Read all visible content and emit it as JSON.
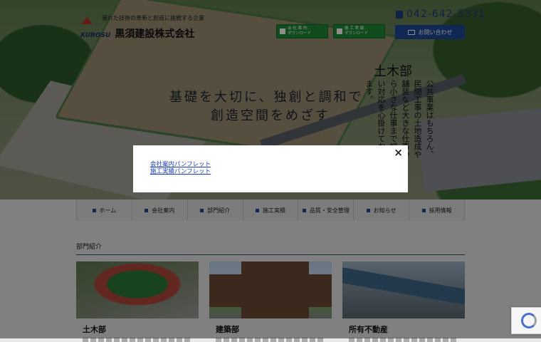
{
  "header": {
    "tagline": "優れた技術の革新と創造に挑戦する企業",
    "logo_en": "KUROSU",
    "company": "黒須建設株式会社",
    "phone": "042-642-5331",
    "download_buttons": [
      {
        "line1": "会 社 案 内",
        "line2": "ダウンロード"
      },
      {
        "line1": "施 工 実 績",
        "line2": "ダウンロード"
      }
    ],
    "contact_label": "お問い合わせ"
  },
  "hero": {
    "slogan_line1": "基礎を大切に、独創と調和で",
    "slogan_line2": "創造空間をめざす",
    "dept_title": "土木部",
    "dept_text": "公共事業はもちろん、民間工事の土地造成や舗装など大きな仕事から小さな仕事まで幅広い対応を心掛けております。"
  },
  "nav": [
    "ホーム",
    "会社案内",
    "部門紹介",
    "施工実績",
    "品質・安全管理",
    "お知らせ",
    "採用情報"
  ],
  "section_title": "部門紹介",
  "cards": [
    {
      "title": "土木部"
    },
    {
      "title": "建築部"
    },
    {
      "title": "所有不動産"
    }
  ],
  "modal": {
    "close": "×",
    "links": [
      "会社案内パンフレット",
      "施工実績パンフレット"
    ]
  },
  "colors": {
    "accent_blue": "#1f4a9c",
    "download_green": "#1f8a3a"
  }
}
